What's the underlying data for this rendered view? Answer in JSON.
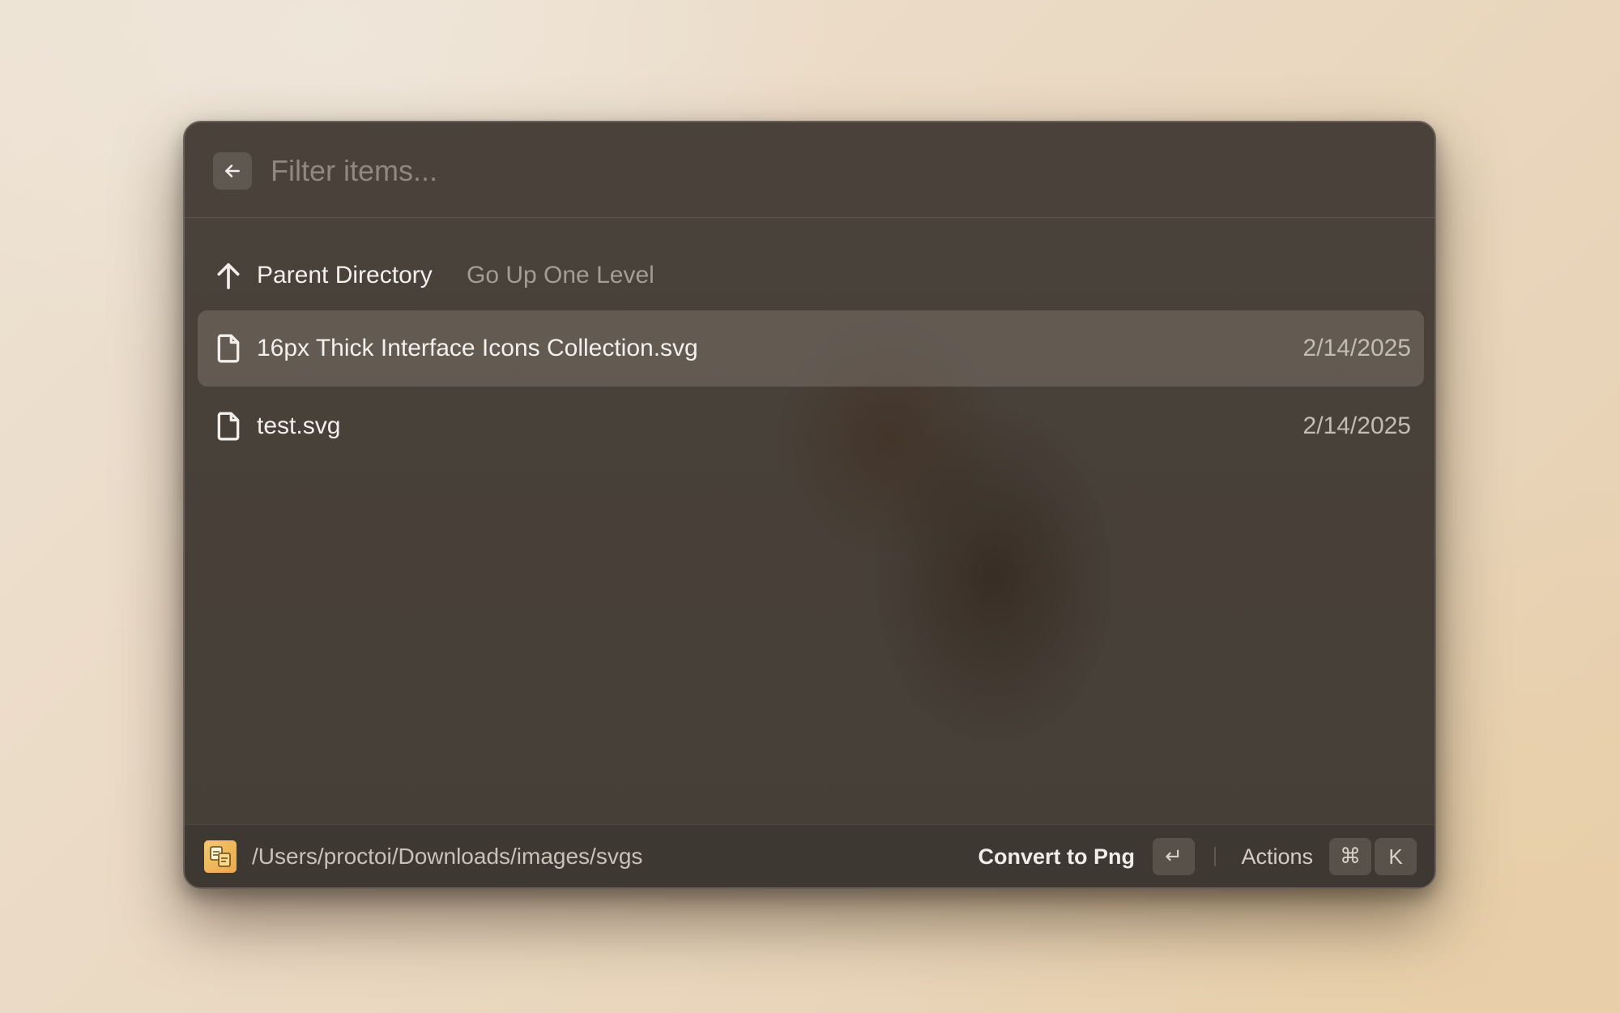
{
  "search": {
    "placeholder": "Filter items...",
    "value": ""
  },
  "list": {
    "parent": {
      "icon": "arrow-up-icon",
      "title": "Parent Directory",
      "subtitle": "Go Up One Level"
    },
    "items": [
      {
        "icon": "document-icon",
        "title": "16px Thick Interface Icons Collection.svg",
        "date": "2/14/2025",
        "selected": true
      },
      {
        "icon": "document-icon",
        "title": "test.svg",
        "date": "2/14/2025",
        "selected": false
      }
    ]
  },
  "footer": {
    "path": "/Users/proctoi/Downloads/images/svgs",
    "primary_action": "Convert to Png",
    "primary_key": "↵",
    "actions_label": "Actions",
    "actions_keys": [
      "⌘",
      "K"
    ]
  },
  "colors": {
    "window_bg": "#4a423a",
    "selected_row": "#5a534c",
    "footer_bg": "#3e3833",
    "accent_icon": "#f4c86a"
  }
}
